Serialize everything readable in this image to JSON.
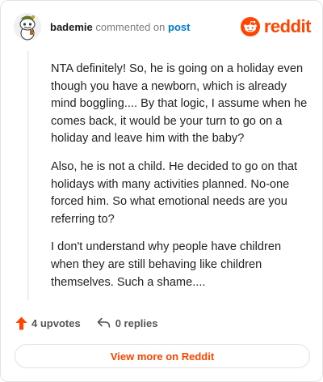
{
  "header": {
    "username": "bademie",
    "verb": "commented on",
    "post_link": "post",
    "brand": "reddit"
  },
  "comment": {
    "paragraphs": [
      "NTA definitely! So, he is going on a holiday even though you have a newborn, which is already mind boggling.... By that logic, I assume when he comes back, it would be your turn to go on a holiday and leave him with the baby?",
      "Also, he is not a child. He decided to go on that holidays with many activities planned. No-one forced him. So what emotional needs are you referring to?",
      "I don't understand why people have children when they are still behaving like children themselves. Such a shame...."
    ]
  },
  "actions": {
    "upvotes": "4 upvotes",
    "replies": "0 replies"
  },
  "footer": {
    "view_more": "View more on Reddit"
  },
  "colors": {
    "accent": "#ff4500",
    "link": "#0079d3",
    "muted": "#7c7c7c"
  },
  "icons": [
    "avatar-snoo",
    "reddit-logo-icon",
    "upvote-arrow-icon",
    "reply-arrow-icon"
  ]
}
